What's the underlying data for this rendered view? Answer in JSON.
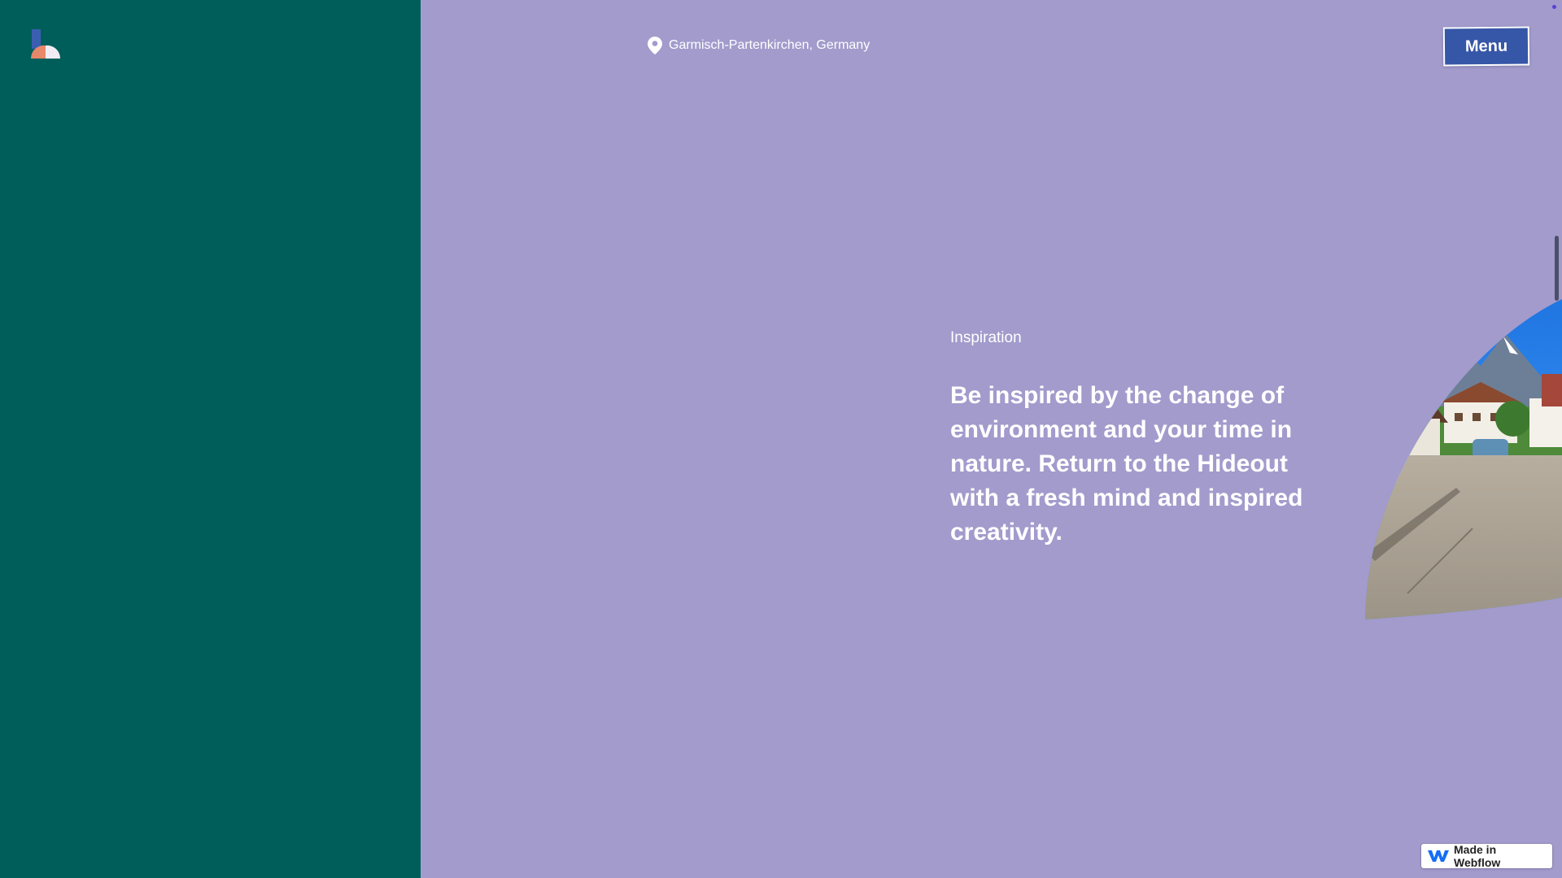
{
  "header": {
    "logo_icon": "hideout-logo-icon",
    "location_icon": "map-pin-icon",
    "location_text": "Garmisch-Partenkirchen, Germany",
    "menu_label": "Menu"
  },
  "section": {
    "label": "Inspiration",
    "text": "Be inspired by the change of environment and your time in nature. Return to the Hideout with a fresh mind and inspired creativity."
  },
  "badge": {
    "icon": "webflow-icon",
    "label": "Made in Webflow"
  },
  "colors": {
    "left_panel": "#005e5a",
    "page_background": "#a29bcc",
    "menu_button": "#3656a7",
    "text": "#ffffff"
  }
}
